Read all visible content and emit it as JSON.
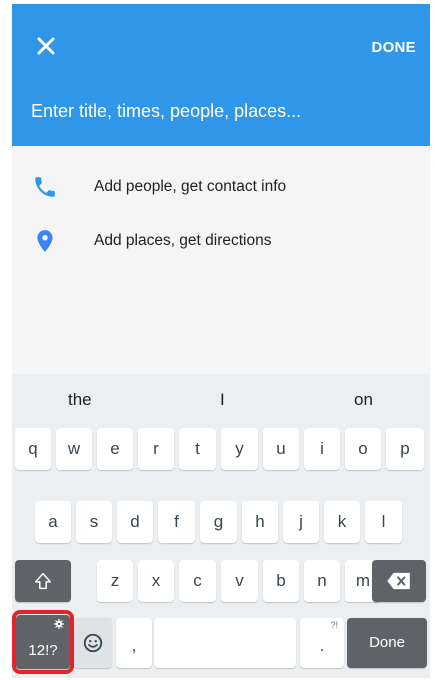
{
  "app_bar": {
    "close_icon": "close-icon",
    "done_label": "DONE",
    "title_placeholder": "Enter title, times, people, places..."
  },
  "options": [
    {
      "icon": "phone-icon",
      "label": "Add people, get contact info"
    },
    {
      "icon": "location-pin-icon",
      "label": "Add places, get directions"
    }
  ],
  "keyboard": {
    "suggestions": [
      "the",
      "I",
      "on"
    ],
    "row1": [
      "q",
      "w",
      "e",
      "r",
      "t",
      "y",
      "u",
      "i",
      "o",
      "p"
    ],
    "row2": [
      "a",
      "s",
      "d",
      "f",
      "g",
      "h",
      "j",
      "k",
      "l"
    ],
    "row3": [
      "z",
      "x",
      "c",
      "v",
      "b",
      "n",
      "m"
    ],
    "symbols_label": "12!?",
    "comma": ",",
    "period": ".",
    "period_hint": "?!",
    "done_label": "Done"
  },
  "colors": {
    "accent": "#2f96e8",
    "pin": "#3f82f5",
    "highlight": "#e3242b"
  }
}
